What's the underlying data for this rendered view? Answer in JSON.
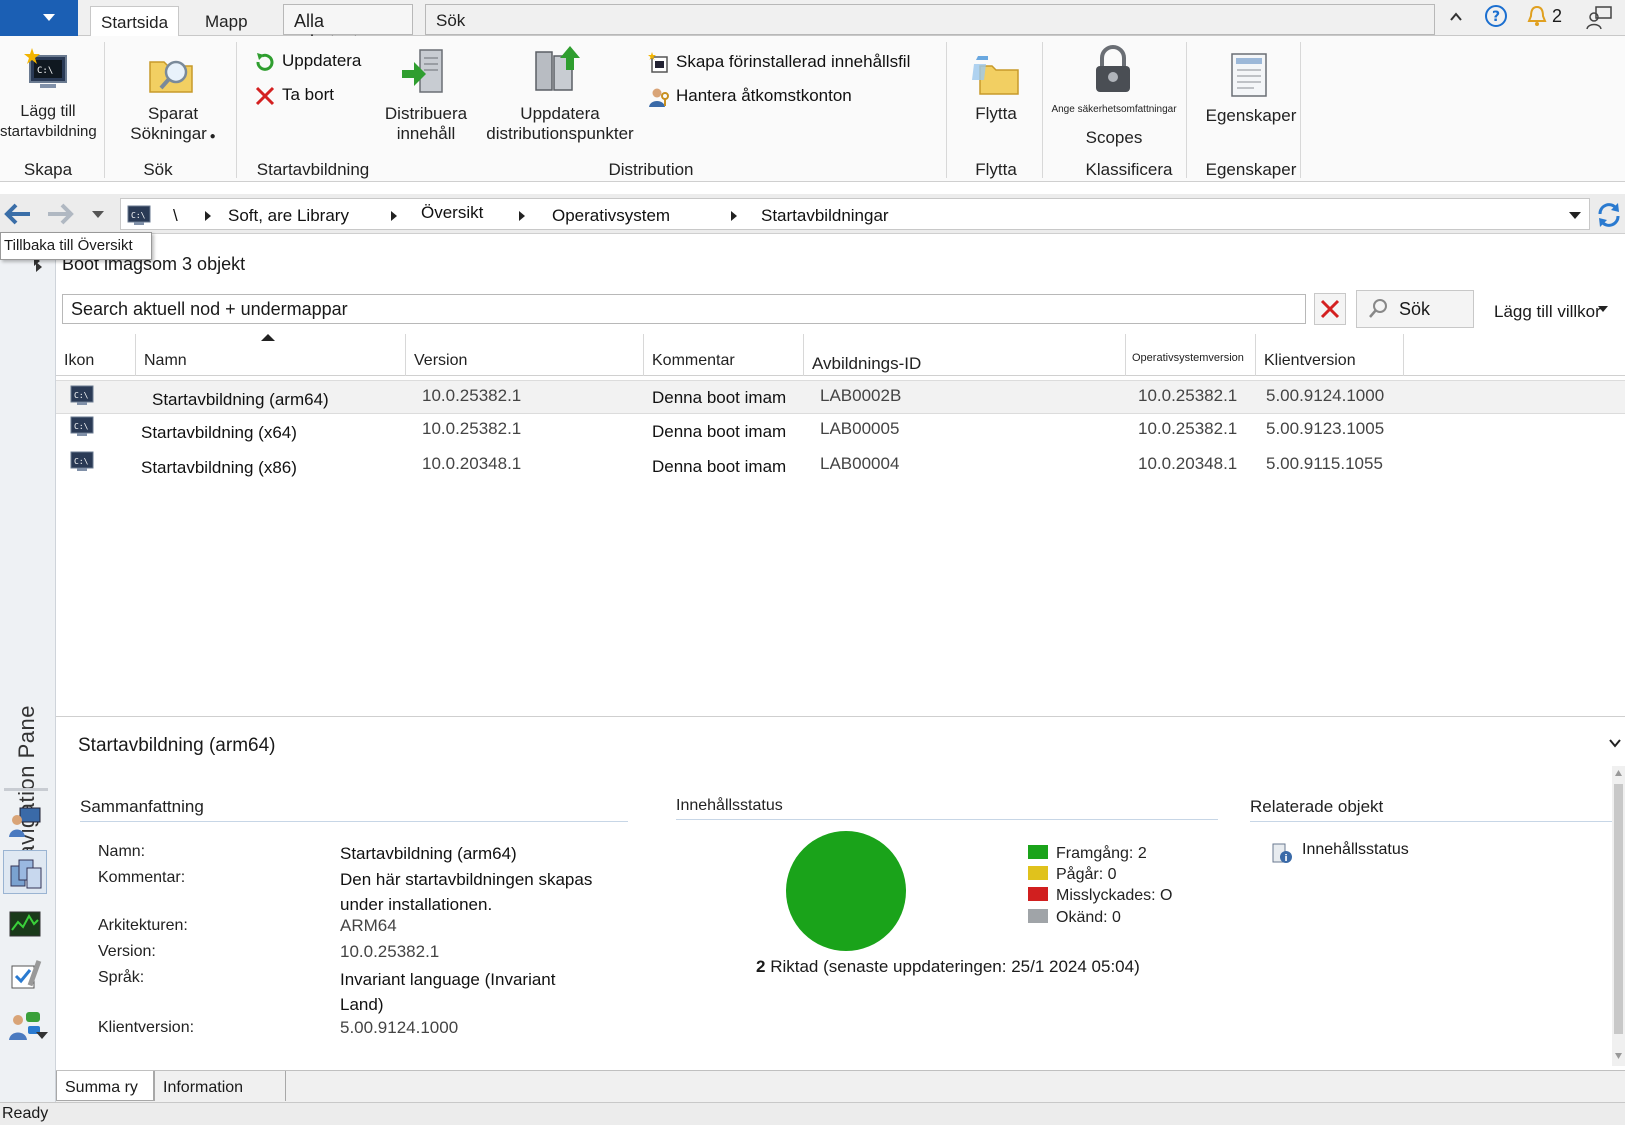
{
  "tabs": [
    "Startsida",
    "Mapp",
    "Alla arbetsytor",
    "Sök"
  ],
  "titlebar": {
    "notification_count": "2"
  },
  "ribbon": {
    "add_boot_image": "Lägg till startavbildning",
    "add_boot_image_l1": "Lägg till",
    "add_boot_image_l2": "startavbildning",
    "group_create": "Skapa",
    "saved_searches_l1": "Sparat",
    "saved_searches_l2": "Sökningar",
    "group_search": "Sök",
    "update": "Uppdatera",
    "delete": "Ta bort",
    "group_boot_image": "Startavbildning",
    "distribute_l1": "Distribuera",
    "distribute_l2": "innehåll",
    "update_dp_l1": "Uppdatera",
    "update_dp_l2": "distributionspunkter",
    "create_prestaged": "Skapa förinstallerad innehållsfil",
    "manage_access": "Hantera åtkomstkonton",
    "group_distribution": "Distribution",
    "move": "Flytta",
    "group_move": "Flytta",
    "set_scopes_small": "Ange säkerhetsomfattningar",
    "scopes": "Scopes",
    "group_classify": "Klassificera",
    "properties": "Egenskaper",
    "group_properties": "Egenskaper"
  },
  "address": {
    "root": "\\",
    "crumbs": [
      "Soft, are Library",
      "Översikt",
      "Operativsystem",
      "Startavbildningar"
    ]
  },
  "tooltip": "Tillbaka till Översikt",
  "navpane": {
    "label": "Navigation Pane"
  },
  "list": {
    "title": "Boot imagsom 3 objekt",
    "search_placeholder": "Search aktuell nod + undermappar",
    "search_button": "Sök",
    "add_criteria": "Lägg till villkor",
    "columns": [
      "Ikon",
      "Namn",
      "Version",
      "Kommentar",
      "Avbildnings-ID",
      "Operativsystemversion",
      "Klientversion"
    ],
    "rows": [
      {
        "name": "Startavbildning (arm64)",
        "version": "10.0.25382.1",
        "comment": "Denna boot imam",
        "image_id": "LAB0002B",
        "os_version": "10.0.25382.1",
        "client_version": "5.00.9124.1000"
      },
      {
        "name": "Startavbildning (x64)",
        "version": "10.0.25382.1",
        "comment": "Denna boot imam",
        "image_id": "LAB00005",
        "os_version": "10.0.25382.1",
        "client_version": "5.00.9123.1005"
      },
      {
        "name": "Startavbildning (x86)",
        "version": "10.0.20348.1",
        "comment": "Denna boot imam",
        "image_id": "LAB00004",
        "os_version": "10.0.20348.1",
        "client_version": "5.00.9115.1055"
      }
    ]
  },
  "detail": {
    "title": "Startavbildning (arm64)",
    "summary_header": "Sammanfattning",
    "fields": {
      "name_label": "Namn:",
      "name_value": "Startavbildning (arm64)",
      "comment_label": "Kommentar:",
      "comment_value_l1": "Den här startavbildningen skapas",
      "comment_value_l2": "under installationen.",
      "arch_label": "Arkitekturen:",
      "arch_value": "ARM64",
      "version_label": "Version:",
      "version_value": "10.0.25382.1",
      "lang_label": "Språk:",
      "lang_value_l1": "Invariant language (Invariant",
      "lang_value_l2": "Land)",
      "client_label": "Klientversion:",
      "client_value": "5.00.9124.1000"
    },
    "content_status_header": "Innehållsstatus",
    "legend": [
      {
        "label": "Framgång: 2",
        "color": "#1aa31a"
      },
      {
        "label": "Pågår: 0",
        "color": "#e0c21c"
      },
      {
        "label": "Misslyckades: O",
        "color": "#d11f1f"
      },
      {
        "label": "Okänd: 0",
        "color": "#a0a4a8"
      }
    ],
    "targeted_count": "2",
    "targeted_text": "Riktad (senaste uppdateringen: 25/1 2024 05:04)",
    "related_header": "Relaterade objekt",
    "related_item": "Innehållsstatus"
  },
  "chart_data": {
    "type": "pie",
    "categories": [
      "Framgång",
      "Pågår",
      "Misslyckades",
      "Okänd"
    ],
    "values": [
      2,
      0,
      0,
      0
    ],
    "colors": [
      "#1aa31a",
      "#e0c21c",
      "#d11f1f",
      "#a0a4a8"
    ]
  },
  "bottom_tabs": [
    "Summa ry",
    "Information"
  ],
  "status": "Ready"
}
